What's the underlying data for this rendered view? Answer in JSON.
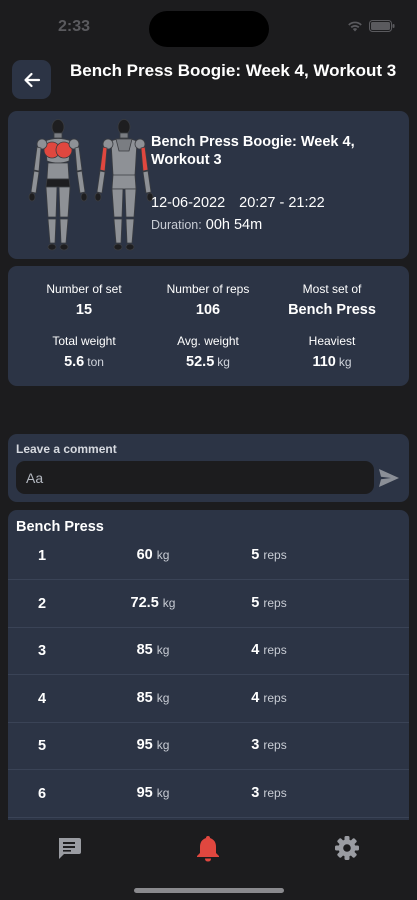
{
  "status": {
    "time": "2:33"
  },
  "header": {
    "title": "Bench Press Boogie: Week 4, Workout 3"
  },
  "summary": {
    "name": "Bench Press Boogie: Week 4, Workout 3",
    "date": "12-06-2022",
    "time_range": "20:27 - 21:22",
    "duration_label": "Duration:",
    "duration_value": "00h 54m",
    "highlight_muscle_color": "#e0473f"
  },
  "stats": {
    "sets": {
      "label": "Number of set",
      "value": "15"
    },
    "reps": {
      "label": "Number of reps",
      "value": "106"
    },
    "most": {
      "label": "Most set of",
      "value": "Bench Press"
    },
    "total_weight": {
      "label": "Total weight",
      "value": "5.6",
      "unit": "ton"
    },
    "avg_weight": {
      "label": "Avg. weight",
      "value": "52.5",
      "unit": "kg"
    },
    "heaviest": {
      "label": "Heaviest",
      "value": "110",
      "unit": "kg"
    }
  },
  "comment": {
    "label": "Leave a comment",
    "placeholder": "Aa",
    "value": ""
  },
  "exercise": {
    "title": "Bench Press",
    "weight_unit": "kg",
    "reps_unit": "reps",
    "sets": [
      {
        "num": "1",
        "weight": "60",
        "reps": "5"
      },
      {
        "num": "2",
        "weight": "72.5",
        "reps": "5"
      },
      {
        "num": "3",
        "weight": "85",
        "reps": "4"
      },
      {
        "num": "4",
        "weight": "85",
        "reps": "4"
      },
      {
        "num": "5",
        "weight": "95",
        "reps": "3"
      },
      {
        "num": "6",
        "weight": "95",
        "reps": "3"
      }
    ]
  },
  "tabs": [
    {
      "name": "chat-icon",
      "color": "#9a9ca2"
    },
    {
      "name": "bell-icon",
      "color": "#e0473f"
    },
    {
      "name": "gear-icon",
      "color": "#9a9ca2"
    }
  ],
  "colors": {
    "background": "#1c1c1e",
    "card": "#2c3445",
    "accent": "#e0473f"
  }
}
